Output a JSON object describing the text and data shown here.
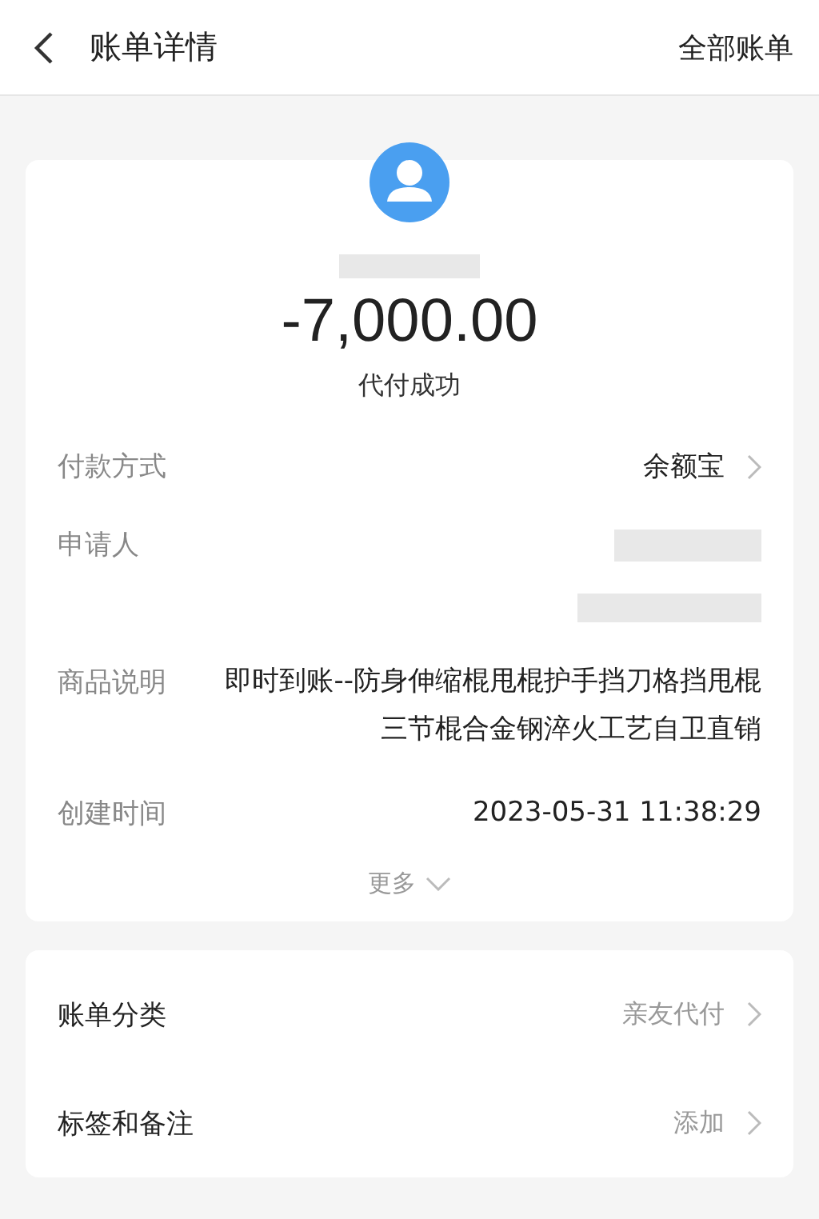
{
  "header": {
    "title": "账单详情",
    "action": "全部账单"
  },
  "summary": {
    "amount": "-7,000.00",
    "status": "代付成功"
  },
  "details": [
    {
      "kind": "link",
      "label": "付款方式",
      "value": "余额宝"
    },
    {
      "kind": "redacted",
      "label": "申请人"
    },
    {
      "kind": "text",
      "label": "商品说明",
      "value": "即时到账--防身伸缩棍甩棍护手挡刀格挡甩棍三节棍合金钢淬火工艺自卫直销"
    },
    {
      "kind": "text",
      "label": "创建时间",
      "value": "2023-05-31 11:38:29"
    }
  ],
  "more": "更多",
  "settings": [
    {
      "label": "账单分类",
      "value": "亲友代付"
    },
    {
      "label": "标签和备注",
      "value": "添加"
    }
  ]
}
